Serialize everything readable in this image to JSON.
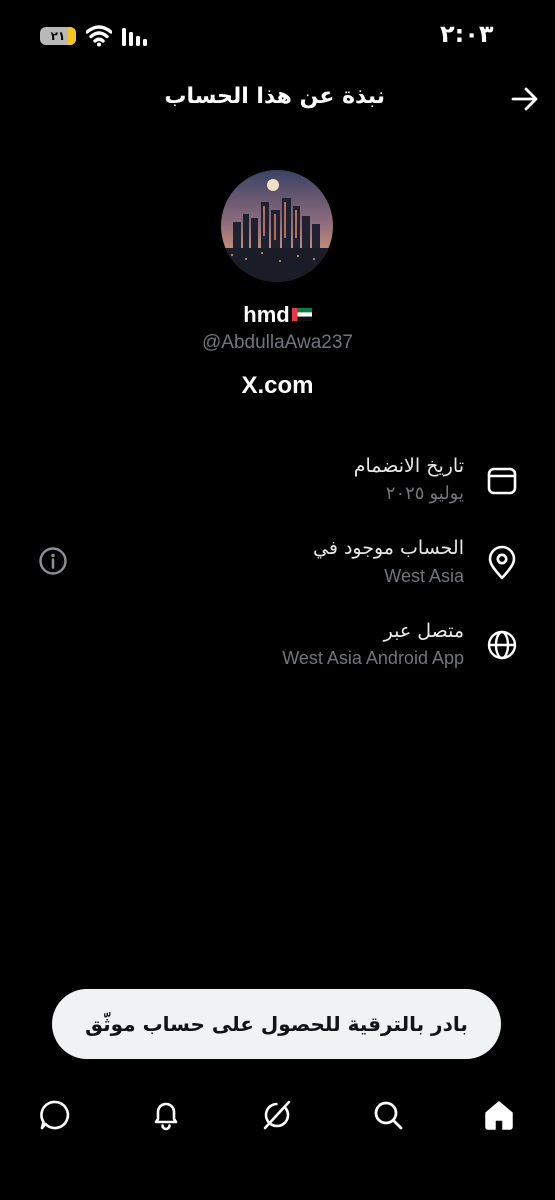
{
  "status_bar": {
    "time": "٢:٠٣",
    "battery_level": "٢١"
  },
  "header": {
    "title": "نبذة عن هذا الحساب"
  },
  "profile": {
    "name": "hmd",
    "handle": "@AbdullaAwa237",
    "link": "X.com"
  },
  "info": {
    "joined_label": "تاريخ الانضمام",
    "joined_value": "يوليو ٢٠٢٥",
    "location_label": "الحساب موجود في",
    "location_value": "West Asia",
    "connected_label": "متصل عبر",
    "connected_value": "West Asia Android App"
  },
  "upgrade_button": "بادر بالترقية للحصول على حساب موثّق",
  "icons": {
    "back": "arrow-right-icon",
    "calendar": "calendar-icon",
    "location": "location-pin-icon",
    "globe": "globe-icon",
    "info": "info-icon",
    "nav": [
      "chat-icon",
      "bell-icon",
      "grok-icon",
      "search-icon",
      "home-icon"
    ]
  },
  "colors": {
    "background": "#000000",
    "text": "#ffffff",
    "secondary_text": "#71767b",
    "pill": "#eff3f4",
    "battery_fill": "#f5c518"
  }
}
